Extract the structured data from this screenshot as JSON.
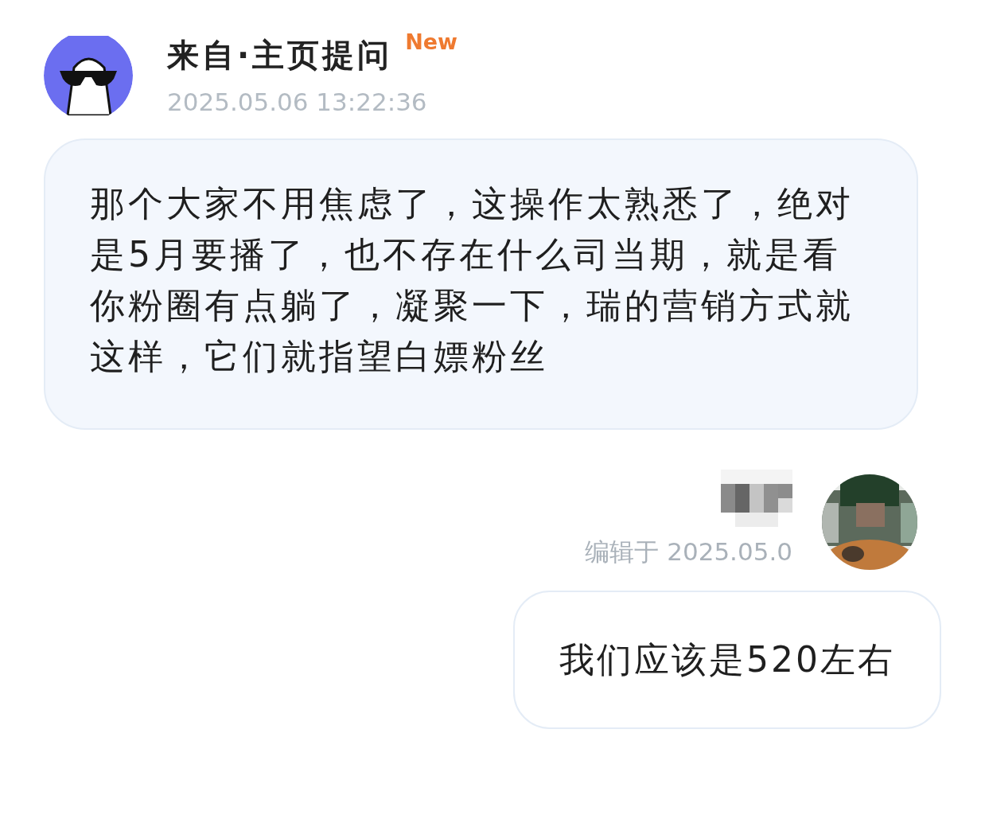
{
  "question": {
    "sender": "来自·主页提问",
    "badge": "New",
    "time": "2025.05.06 13:22:36",
    "message": "那个大家不用焦虑了，这操作太熟悉了，绝对是5月要播了，也不存在什么司当期，就是看你粉圈有点躺了，凝聚一下，瑞的营销方式就这样，它们就指望白嫖粉丝"
  },
  "reply": {
    "edited_time": "编辑于 2025.05.0",
    "message": "我们应该是520左右"
  }
}
